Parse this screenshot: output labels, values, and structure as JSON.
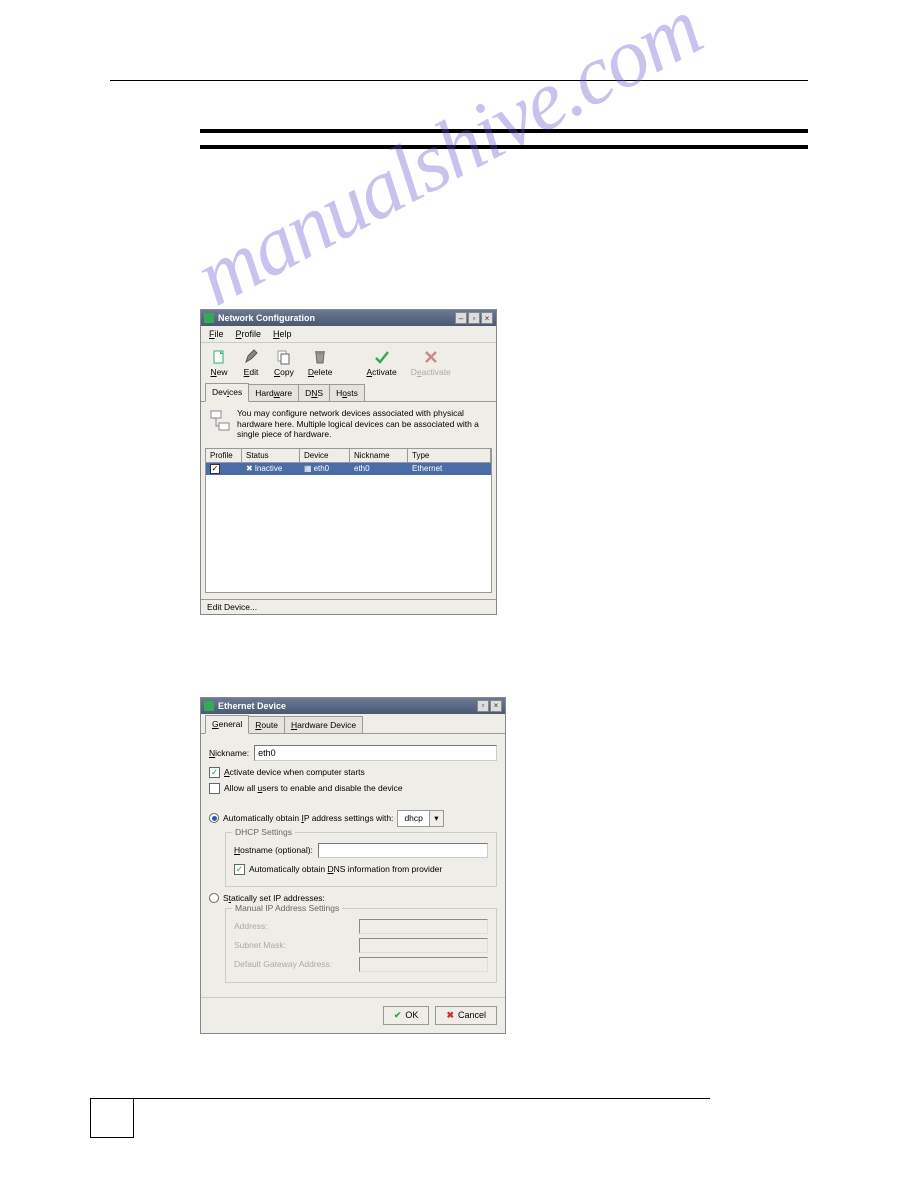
{
  "watermark": "manualshive.com",
  "window1": {
    "title": "Network Configuration",
    "menu": {
      "file": "File",
      "profile": "Profile",
      "help": "Help"
    },
    "toolbar": {
      "new": "New",
      "edit": "Edit",
      "copy": "Copy",
      "delete": "Delete",
      "activate": "Activate",
      "deactivate": "Deactivate"
    },
    "tabs": {
      "devices": "Devices",
      "hardware": "Hardware",
      "dns": "DNS",
      "hosts": "Hosts"
    },
    "info": "You may configure network devices associated with physical hardware here.  Multiple logical devices can be associated with a single piece of hardware.",
    "headers": {
      "profile": "Profile",
      "status": "Status",
      "device": "Device",
      "nickname": "Nickname",
      "type": "Type"
    },
    "row": {
      "status": "Inactive",
      "device": "eth0",
      "nickname": "eth0",
      "type": "Ethernet"
    },
    "statusbar": "Edit Device..."
  },
  "window2": {
    "title": "Ethernet Device",
    "tabs": {
      "general": "General",
      "route": "Route",
      "hardware": "Hardware Device"
    },
    "nickname_label": "Nickname:",
    "nickname_value": "eth0",
    "activate_label": "Activate device when computer starts",
    "allow_label": "Allow all users to enable and disable the device",
    "auto_ip_label": "Automatically obtain IP address settings with:",
    "dhcp": "dhcp",
    "dhcp_legend": "DHCP Settings",
    "hostname_label": "Hostname (optional):",
    "auto_dns_label": "Automatically obtain DNS information from provider",
    "static_label": "Statically set IP addresses:",
    "manual_legend": "Manual IP Address Settings",
    "address_label": "Address:",
    "subnet_label": "Subnet Mask:",
    "gateway_label": "Default Gateway Address:",
    "ok": "OK",
    "cancel": "Cancel"
  }
}
